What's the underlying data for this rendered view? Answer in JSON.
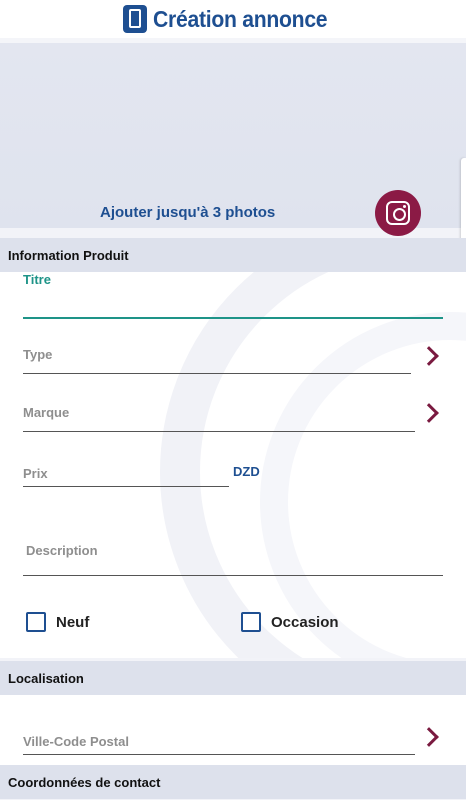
{
  "header": {
    "title": "Création annonce",
    "icon": "phone-icon"
  },
  "photos": {
    "add_label": "Ajouter jusqu'à 3 photos",
    "icon": "camera-icon"
  },
  "sections": {
    "product": "Information Produit",
    "location": "Localisation",
    "contact": "Coordonnées de contact"
  },
  "fields": {
    "title": "Titre",
    "type": "Type",
    "brand": "Marque",
    "price": "Prix",
    "currency": "DZD",
    "description": "Description",
    "city": "Ville-Code Postal"
  },
  "condition": {
    "new_label": "Neuf",
    "used_label": "Occasion"
  },
  "colors": {
    "primary": "#1e4f91",
    "accent": "#8b1a45",
    "focus": "#1e9488"
  }
}
